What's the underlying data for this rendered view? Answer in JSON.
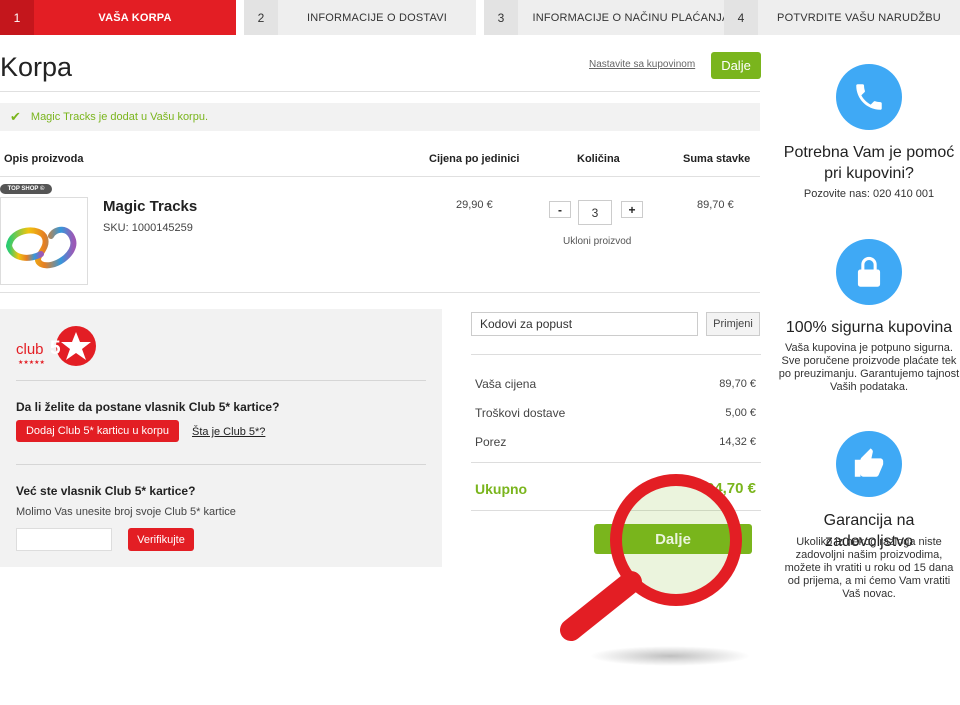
{
  "steps": [
    {
      "num": "1",
      "label": "VAŠA KORPA"
    },
    {
      "num": "2",
      "label": "INFORMACIJE O DOSTAVI"
    },
    {
      "num": "3",
      "label": "INFORMACIJE O NAČINU PLAĆANJA"
    },
    {
      "num": "4",
      "label": "POTVRDITE VAŠU NARUDŽBU"
    }
  ],
  "page": {
    "title": "Korpa",
    "continue_link": "Nastavite sa kupovinom",
    "next_label": "Dalje",
    "notice": "Magic Tracks je dodat u Vašu korpu."
  },
  "table": {
    "headers": [
      "Opis proizvoda",
      "Cijena po jedinici",
      "Količina",
      "Suma stavke"
    ]
  },
  "item": {
    "badge": "TOP SHOP ©",
    "name": "Magic Tracks",
    "sku": "SKU: 1000145259",
    "unit_price": "29,90 €",
    "quantity": "3",
    "minus": "-",
    "plus": "+",
    "remove": "Ukloni proizvod",
    "sum": "89,70 €"
  },
  "club": {
    "logo_text": "club",
    "logo_number": "5",
    "question1": "Da li želite da postane vlasnik Club 5* kartice?",
    "add_button": "Dodaj Club 5* karticu u korpu",
    "what_link": "Šta je Club 5*?",
    "question2": "Već ste vlasnik Club 5* kartice?",
    "help": "Molimo Vas unesite broj svoje Club 5* kartice",
    "verify_button": "Verifikujte"
  },
  "coupon": {
    "placeholder": "Kodovi za popust",
    "apply": "Primjeni"
  },
  "summary": {
    "rows": [
      {
        "label": "Vaša cijena",
        "value": "89,70 €"
      },
      {
        "label": "Troškovi dostave",
        "value": "5,00 €"
      },
      {
        "label": "Porez",
        "value": "14,32 €"
      }
    ],
    "total_label": "Ukupno",
    "total_value": "94,70 €",
    "next_label": "Dalje"
  },
  "sidebar": {
    "help_title": "Potrebna Vam je pomoć pri kupovini?",
    "help_text": "Pozovite nas: 020 410 001",
    "secure_title": "100% sigurna kupovina",
    "secure_text": "Vaša kupovina je potpuno sigurna. Sve poručene proizvode plaćate tek po preuzimanju. Garantujemo tajnost Vaših podataka.",
    "guarantee_title": "Garancija na zadovoljstvo",
    "guarantee_text": "Ukoliko iz nekog razloga niste zadovoljni našim proizvodima, možete ih vratiti u roku od 15 dana od prijema, a mi ćemo Vam vratiti Vaš novac."
  },
  "colors": {
    "brand_red": "#e31e24",
    "accent_green": "#7ab51d",
    "icon_blue": "#3fa9f5"
  },
  "icons": [
    "check-icon",
    "phone-icon",
    "lock-icon",
    "thumbs-up-icon",
    "magnifier-icon"
  ]
}
